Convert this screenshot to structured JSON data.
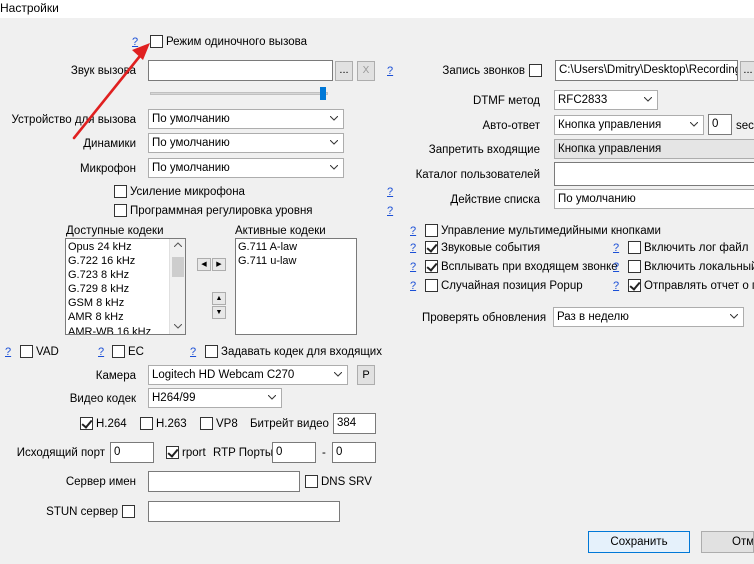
{
  "window": {
    "title": "Настройки"
  },
  "help_label": "?",
  "single_call_mode": {
    "label": "Режим одиночного вызова",
    "checked": false
  },
  "ring_sound": {
    "label": "Звук вызова",
    "value": "",
    "browse": "...",
    "clear": "X",
    "volume_fraction": 0.97
  },
  "call_device": {
    "label": "Устройство для вызова",
    "value": "По умолчанию"
  },
  "speakers": {
    "label": "Динамики",
    "value": "По умолчанию"
  },
  "microphone": {
    "label": "Микрофон",
    "value": "По умолчанию"
  },
  "mic_boost": {
    "label": "Усиление микрофона",
    "checked": false
  },
  "software_level": {
    "label": "Программная регулировка уровня",
    "checked": false
  },
  "codecs": {
    "available_label": "Доступные кодеки",
    "active_label": "Активные кодеки",
    "available": [
      "Opus 24 kHz",
      "G.722 16 kHz",
      "G.723 8 kHz",
      "G.729 8 kHz",
      "GSM 8 kHz",
      "AMR 8 kHz",
      "AMR-WB 16 kHz"
    ],
    "active": [
      "G.711 A-law",
      "G.711 u-law"
    ]
  },
  "vad": {
    "label": "VAD",
    "checked": false
  },
  "ec": {
    "label": "EC",
    "checked": false
  },
  "incoming_codec": {
    "label": "Задавать кодек для входящих",
    "checked": false
  },
  "camera": {
    "label": "Камера",
    "value": "Logitech HD Webcam C270",
    "props": "P"
  },
  "video_codec": {
    "label": "Видео кодек",
    "value": "H264/99"
  },
  "h264": {
    "label": "H.264",
    "checked": true
  },
  "h263": {
    "label": "H.263",
    "checked": false
  },
  "vp8": {
    "label": "VP8",
    "checked": false
  },
  "video_bitrate": {
    "label": "Битрейт видео",
    "value": "384"
  },
  "out_port": {
    "label": "Исходящий порт",
    "value": "0"
  },
  "rport": {
    "label": "rport",
    "checked": true
  },
  "rtp_ports": {
    "label": "RTP Порты",
    "from": "0",
    "sep": "-",
    "to": "0"
  },
  "server_name": {
    "label": "Сервер имен",
    "value": ""
  },
  "dns_srv": {
    "label": "DNS SRV",
    "checked": false
  },
  "stun": {
    "label": "STUN сервер",
    "checked": false,
    "value": ""
  },
  "recording": {
    "label": "Запись звонков",
    "checked": false,
    "path": "C:\\Users\\Dmitry\\Desktop\\Recordings",
    "browse": "..."
  },
  "dtmf": {
    "label": "DTMF метод",
    "value": "RFC2833"
  },
  "auto_answer": {
    "label": "Авто-ответ",
    "value": "Кнопка управления",
    "seconds": "0",
    "sec_label": "sec"
  },
  "deny_incoming": {
    "label": "Запретить входящие",
    "value": "Кнопка управления"
  },
  "user_dir": {
    "label": "Каталог пользователей",
    "value": ""
  },
  "list_action": {
    "label": "Действие списка",
    "value": "По умолчанию"
  },
  "mm_buttons": {
    "label": "Управление мультимедийными кнопками",
    "checked": false
  },
  "sound_events": {
    "label": "Звуковые события",
    "checked": true
  },
  "enable_log": {
    "label": "Включить лог файл",
    "checked": false
  },
  "popup_incoming": {
    "label": "Всплывать при входящем звонке",
    "checked": true
  },
  "enable_local": {
    "label": "Включить локальный",
    "checked": false
  },
  "random_popup": {
    "label": "Случайная позиция Popup",
    "checked": false
  },
  "send_report": {
    "label": "Отправлять отчет о п",
    "checked": true
  },
  "check_updates": {
    "label": "Проверять обновления",
    "value": "Раз в неделю"
  },
  "buttons": {
    "save": "Сохранить",
    "cancel": "Отм"
  },
  "colors": {
    "accent": "#0078d7",
    "help_link": "#1a4fd6",
    "annotation_arrow": "#e02020"
  }
}
